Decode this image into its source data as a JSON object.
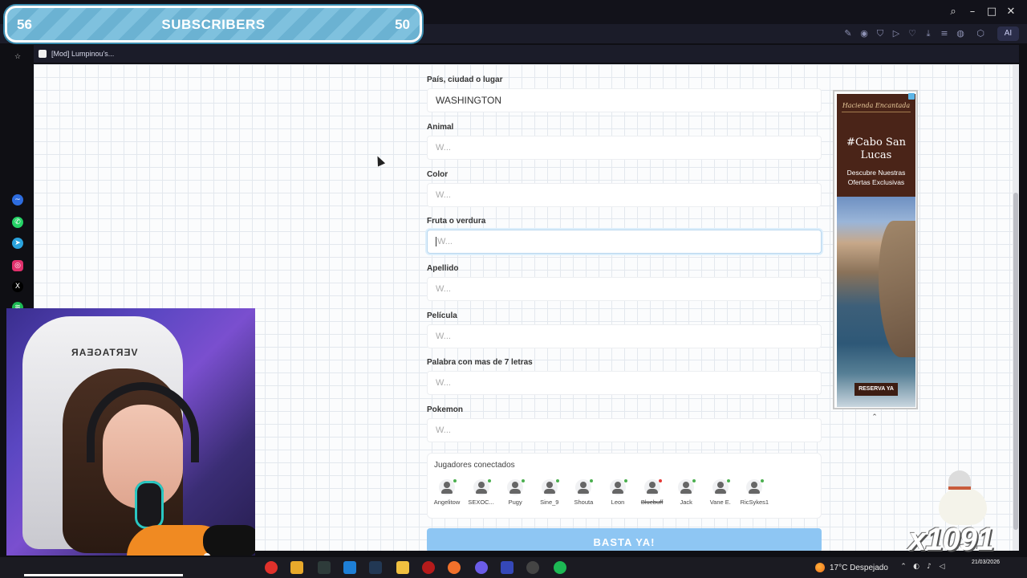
{
  "browser": {
    "tab_title": "[Mod] Lumpinou's...",
    "ai_label": "AI"
  },
  "overlay": {
    "subs_left": "56",
    "subs_title": "SUBSCRIBERS",
    "subs_right": "50"
  },
  "chair_brand": "VERTAGEAR",
  "form": {
    "fields": [
      {
        "label": "País, ciudad o lugar",
        "value": "WASHINGTON",
        "placeholder": ""
      },
      {
        "label": "Animal",
        "value": "",
        "placeholder": "W..."
      },
      {
        "label": "Color",
        "value": "",
        "placeholder": "W..."
      },
      {
        "label": "Fruta o verdura",
        "value": "",
        "placeholder": "W..."
      },
      {
        "label": "Apellido",
        "value": "",
        "placeholder": "W..."
      },
      {
        "label": "Película",
        "value": "",
        "placeholder": "W..."
      },
      {
        "label": "Palabra con mas de 7 letras",
        "value": "",
        "placeholder": "W..."
      },
      {
        "label": "Pokemon",
        "value": "",
        "placeholder": "W..."
      }
    ],
    "players_title": "Jugadores conectados",
    "players": [
      {
        "name": "Angelitow",
        "status_color": "#4caf50",
        "strike": false
      },
      {
        "name": "SEXOC...",
        "status_color": "#4caf50",
        "strike": false
      },
      {
        "name": "Pugy",
        "status_color": "#4caf50",
        "strike": false
      },
      {
        "name": "Sine_9",
        "status_color": "#4caf50",
        "strike": false
      },
      {
        "name": "Shouta",
        "status_color": "#4caf50",
        "strike": false
      },
      {
        "name": "Leon",
        "status_color": "#4caf50",
        "strike": false
      },
      {
        "name": "Bluebuff",
        "status_color": "#e53935",
        "strike": true
      },
      {
        "name": "Jack",
        "status_color": "#4caf50",
        "strike": false
      },
      {
        "name": "Vane E.",
        "status_color": "#4caf50",
        "strike": false
      },
      {
        "name": "RicSykes1",
        "status_color": "#4caf50",
        "strike": false
      }
    ],
    "submit_label": "BASTA YA!"
  },
  "ad": {
    "brand": "Hacienda Encantada",
    "headline": "#Cabo San Lucas",
    "sub": "Descubre Nuestras Ofertas Exclusivas",
    "cta": "RESERVA YA"
  },
  "watermark": "x1091",
  "taskbar": {
    "weather": "17°C  Despejado",
    "date": "21/03/2026"
  },
  "colors": {
    "accent": "#8ec6f3",
    "status_online": "#4caf50",
    "status_offline": "#e53935"
  }
}
